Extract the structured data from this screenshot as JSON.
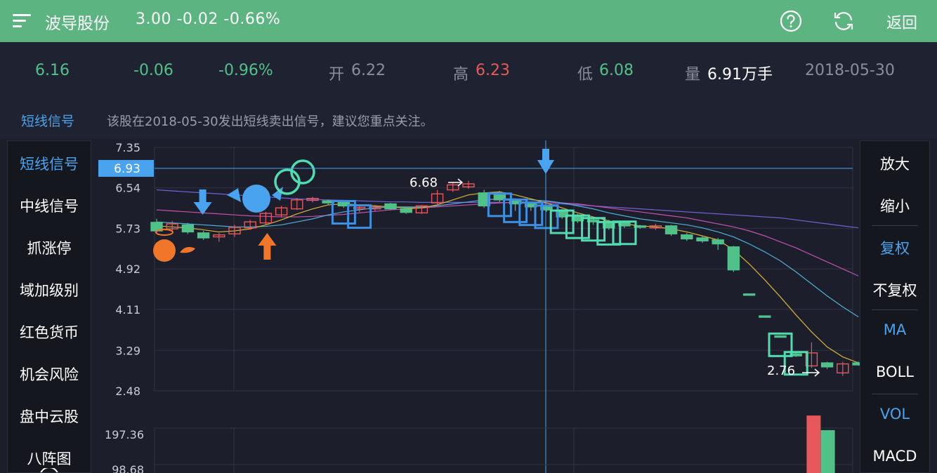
{
  "header": {
    "stock_name": "波导股份",
    "quote": "3.00  -0.02  -0.66%",
    "back_label": "返回"
  },
  "info": {
    "price": "6.16",
    "change": "-0.06",
    "change_pct": "-0.96%",
    "open_label": "开",
    "open": "6.22",
    "high_label": "高",
    "high": "6.23",
    "low_label": "低",
    "low": "6.08",
    "volume_label": "量",
    "volume": "6.91万手",
    "date": "2018-05-30"
  },
  "signal": {
    "label": "短线信号",
    "message": "该股在2018-05-30发出短线卖出信号，建议您重点关注。"
  },
  "left_menu": [
    "短线信号",
    "中线信号",
    "抓涨停",
    "域加级别",
    "红色货币",
    "机会风险",
    "盘中云股",
    "八阵图"
  ],
  "right_menu": [
    "放大",
    "缩小",
    "复权",
    "不复权",
    "MA",
    "BOLL",
    "VOL",
    "MACD"
  ],
  "colors": {
    "up": "#e8585a",
    "down": "#51c18a",
    "accent": "#4aa3ee",
    "header": "#5cb580"
  },
  "icons": [
    "menu-icon",
    "help-icon",
    "refresh-icon"
  ],
  "chart_data": {
    "type": "candlestick",
    "y_ticks": [
      "7.35",
      "6.54",
      "5.73",
      "4.92",
      "4.11",
      "3.29",
      "2.48"
    ],
    "crosshair_value": "6.93",
    "ylim": [
      2.48,
      7.35
    ],
    "annotations": {
      "max_label": "6.68",
      "min_label": "2.76"
    },
    "volume_ticks": [
      "197.36",
      "98.68"
    ],
    "candles": [
      {
        "o": 5.85,
        "c": 5.68,
        "h": 5.92,
        "l": 5.62
      },
      {
        "o": 5.72,
        "c": 5.82,
        "h": 5.88,
        "l": 5.66
      },
      {
        "o": 5.8,
        "c": 5.66,
        "h": 5.84,
        "l": 5.62
      },
      {
        "o": 5.64,
        "c": 5.54,
        "h": 5.68,
        "l": 5.5
      },
      {
        "o": 5.56,
        "c": 5.6,
        "h": 5.64,
        "l": 5.46
      },
      {
        "o": 5.62,
        "c": 5.75,
        "h": 5.8,
        "l": 5.56
      },
      {
        "o": 5.74,
        "c": 5.86,
        "h": 5.9,
        "l": 5.7
      },
      {
        "o": 5.84,
        "c": 6.03,
        "h": 6.06,
        "l": 5.8
      },
      {
        "o": 6.0,
        "c": 6.14,
        "h": 6.18,
        "l": 5.96
      },
      {
        "o": 6.12,
        "c": 6.3,
        "h": 6.34,
        "l": 6.1
      },
      {
        "o": 6.29,
        "c": 6.33,
        "h": 6.36,
        "l": 6.25
      },
      {
        "o": 6.28,
        "c": 6.24,
        "h": 6.31,
        "l": 6.2
      },
      {
        "o": 6.26,
        "c": 6.18,
        "h": 6.3,
        "l": 6.14
      },
      {
        "o": 6.12,
        "c": 6.15,
        "h": 6.18,
        "l": 6.06
      },
      {
        "o": 6.12,
        "c": 6.16,
        "h": 6.2,
        "l": 6.08
      },
      {
        "o": 6.22,
        "c": 6.12,
        "h": 6.24,
        "l": 6.1
      },
      {
        "o": 6.12,
        "c": 6.05,
        "h": 6.16,
        "l": 6.02
      },
      {
        "o": 6.04,
        "c": 6.18,
        "h": 6.2,
        "l": 6.02
      },
      {
        "o": 6.24,
        "c": 6.42,
        "h": 6.5,
        "l": 6.2
      },
      {
        "o": 6.5,
        "c": 6.6,
        "h": 6.64,
        "l": 6.46
      },
      {
        "o": 6.56,
        "c": 6.62,
        "h": 6.68,
        "l": 6.52
      },
      {
        "o": 6.44,
        "c": 6.18,
        "h": 6.5,
        "l": 6.14
      },
      {
        "o": 6.44,
        "c": 6.3,
        "h": 6.48,
        "l": 6.26
      },
      {
        "o": 6.28,
        "c": 6.22,
        "h": 6.32,
        "l": 6.08
      },
      {
        "o": 6.22,
        "c": 6.16,
        "h": 6.23,
        "l": 6.08
      },
      {
        "o": 6.16,
        "c": 6.1,
        "h": 6.2,
        "l": 6.06
      },
      {
        "o": 6.1,
        "c": 5.96,
        "h": 6.12,
        "l": 5.92
      },
      {
        "o": 5.98,
        "c": 5.88,
        "h": 6.02,
        "l": 5.84
      },
      {
        "o": 5.9,
        "c": 5.86,
        "h": 5.94,
        "l": 5.8
      },
      {
        "o": 5.86,
        "c": 5.74,
        "h": 5.9,
        "l": 5.7
      },
      {
        "o": 5.84,
        "c": 5.78,
        "h": 5.88,
        "l": 5.74
      },
      {
        "o": 5.78,
        "c": 5.76,
        "h": 5.8,
        "l": 5.72
      },
      {
        "o": 5.74,
        "c": 5.78,
        "h": 5.82,
        "l": 5.7
      },
      {
        "o": 5.78,
        "c": 5.62,
        "h": 5.8,
        "l": 5.58
      },
      {
        "o": 5.6,
        "c": 5.52,
        "h": 5.64,
        "l": 5.48
      },
      {
        "o": 5.54,
        "c": 5.48,
        "h": 5.58,
        "l": 5.44
      },
      {
        "o": 5.5,
        "c": 5.42,
        "h": 5.54,
        "l": 5.3
      },
      {
        "o": 5.36,
        "c": 4.9,
        "h": 5.38,
        "l": 4.86
      },
      {
        "o": 4.42,
        "c": 4.4,
        "h": 4.42,
        "l": 4.4
      },
      {
        "o": 3.98,
        "c": 3.96,
        "h": 3.98,
        "l": 3.96
      },
      {
        "o": 3.58,
        "c": 3.56,
        "h": 3.58,
        "l": 3.56
      },
      {
        "o": 3.22,
        "c": 3.18,
        "h": 3.24,
        "l": 3.16
      },
      {
        "o": 2.98,
        "c": 3.24,
        "h": 3.45,
        "l": 2.94
      },
      {
        "o": 3.04,
        "c": 2.96,
        "h": 3.06,
        "l": 2.92
      },
      {
        "o": 2.84,
        "c": 3.02,
        "h": 3.06,
        "l": 2.78
      },
      {
        "o": 3.04,
        "c": 3.0,
        "h": 3.07,
        "l": 2.98
      }
    ],
    "ma5": [
      5.78,
      5.76,
      5.74,
      5.7,
      5.66,
      5.68,
      5.72,
      5.8,
      5.9,
      6.02,
      6.12,
      6.2,
      6.22,
      6.2,
      6.18,
      6.16,
      6.14,
      6.14,
      6.2,
      6.3,
      6.4,
      6.44,
      6.46,
      6.4,
      6.32,
      6.24,
      6.14,
      6.04,
      5.96,
      5.88,
      5.82,
      5.78,
      5.76,
      5.72,
      5.66,
      5.58,
      5.5,
      5.3,
      5.02,
      4.7,
      4.36,
      4.0,
      3.66,
      3.36,
      3.16,
      3.04
    ],
    "ma10": [
      5.86,
      5.84,
      5.82,
      5.8,
      5.78,
      5.76,
      5.76,
      5.77,
      5.8,
      5.86,
      5.92,
      6.0,
      6.06,
      6.1,
      6.14,
      6.16,
      6.16,
      6.16,
      6.18,
      6.22,
      6.26,
      6.3,
      6.32,
      6.32,
      6.3,
      6.28,
      6.24,
      6.18,
      6.12,
      6.04,
      5.98,
      5.92,
      5.88,
      5.84,
      5.8,
      5.74,
      5.66,
      5.56,
      5.42,
      5.26,
      5.08,
      4.86,
      4.62,
      4.38,
      4.16,
      3.96
    ],
    "ma20": [
      6.1,
      6.08,
      6.06,
      6.04,
      6.02,
      6.0,
      5.98,
      5.97,
      5.96,
      5.96,
      5.97,
      5.99,
      6.01,
      6.04,
      6.07,
      6.1,
      6.12,
      6.14,
      6.16,
      6.18,
      6.2,
      6.22,
      6.24,
      6.25,
      6.26,
      6.26,
      6.24,
      6.22,
      6.18,
      6.14,
      6.1,
      6.06,
      6.02,
      5.98,
      5.94,
      5.88,
      5.82,
      5.76,
      5.68,
      5.58,
      5.46,
      5.34,
      5.2,
      5.06,
      4.92,
      4.78
    ],
    "ma60": [
      6.5,
      6.48,
      6.46,
      6.44,
      6.42,
      6.4,
      6.38,
      6.36,
      6.34,
      6.32,
      6.31,
      6.3,
      6.29,
      6.28,
      6.27,
      6.26,
      6.26,
      6.25,
      6.25,
      6.25,
      6.25,
      6.25,
      6.25,
      6.24,
      6.24,
      6.23,
      6.22,
      6.2,
      6.18,
      6.16,
      6.14,
      6.12,
      6.1,
      6.08,
      6.06,
      6.04,
      6.02,
      6.0,
      5.98,
      5.96,
      5.94,
      5.9,
      5.86,
      5.82,
      5.78,
      5.74
    ],
    "volume": [
      {
        "v": 0,
        "up": true
      },
      {
        "v": 0,
        "up": true
      },
      {
        "v": 0,
        "up": true
      },
      {
        "v": 0,
        "up": true
      },
      {
        "v": 0,
        "up": true
      },
      {
        "v": 0,
        "up": true
      },
      {
        "v": 0,
        "up": true
      },
      {
        "v": 0,
        "up": true
      },
      {
        "v": 0,
        "up": true
      },
      {
        "v": 0,
        "up": true
      },
      {
        "v": 0,
        "up": true
      },
      {
        "v": 0,
        "up": true
      },
      {
        "v": 0,
        "up": true
      },
      {
        "v": 0,
        "up": true
      },
      {
        "v": 0,
        "up": true
      },
      {
        "v": 0,
        "up": true
      },
      {
        "v": 0,
        "up": true
      },
      {
        "v": 0,
        "up": true
      },
      {
        "v": 0,
        "up": true
      },
      {
        "v": 0,
        "up": true
      },
      {
        "v": 0,
        "up": true
      },
      {
        "v": 0,
        "up": true
      },
      {
        "v": 0,
        "up": true
      },
      {
        "v": 0,
        "up": true
      },
      {
        "v": 0,
        "up": true
      },
      {
        "v": 0,
        "up": true
      },
      {
        "v": 0,
        "up": true
      },
      {
        "v": 0,
        "up": true
      },
      {
        "v": 0,
        "up": true
      },
      {
        "v": 0,
        "up": true
      },
      {
        "v": 0,
        "up": true
      },
      {
        "v": 0,
        "up": true
      },
      {
        "v": 0,
        "up": true
      },
      {
        "v": 0,
        "up": true
      },
      {
        "v": 0,
        "up": true
      },
      {
        "v": 0,
        "up": true
      },
      {
        "v": 0,
        "up": true
      },
      {
        "v": 0,
        "up": true
      },
      {
        "v": 0,
        "up": true
      },
      {
        "v": 0,
        "up": true
      },
      {
        "v": 0,
        "up": true
      },
      {
        "v": 0,
        "up": true
      },
      {
        "v": 197,
        "up": true
      },
      {
        "v": 118,
        "up": false
      },
      {
        "v": 0,
        "up": true
      },
      {
        "v": 0,
        "up": true
      }
    ],
    "signals": {
      "buy_arrows": [
        3
      ],
      "up_arrows": [
        7
      ],
      "sell_arrow_index": 25,
      "sell_boxes": [
        12,
        13,
        22,
        23,
        24,
        25,
        26,
        27,
        28,
        29,
        30,
        40,
        41
      ]
    }
  }
}
